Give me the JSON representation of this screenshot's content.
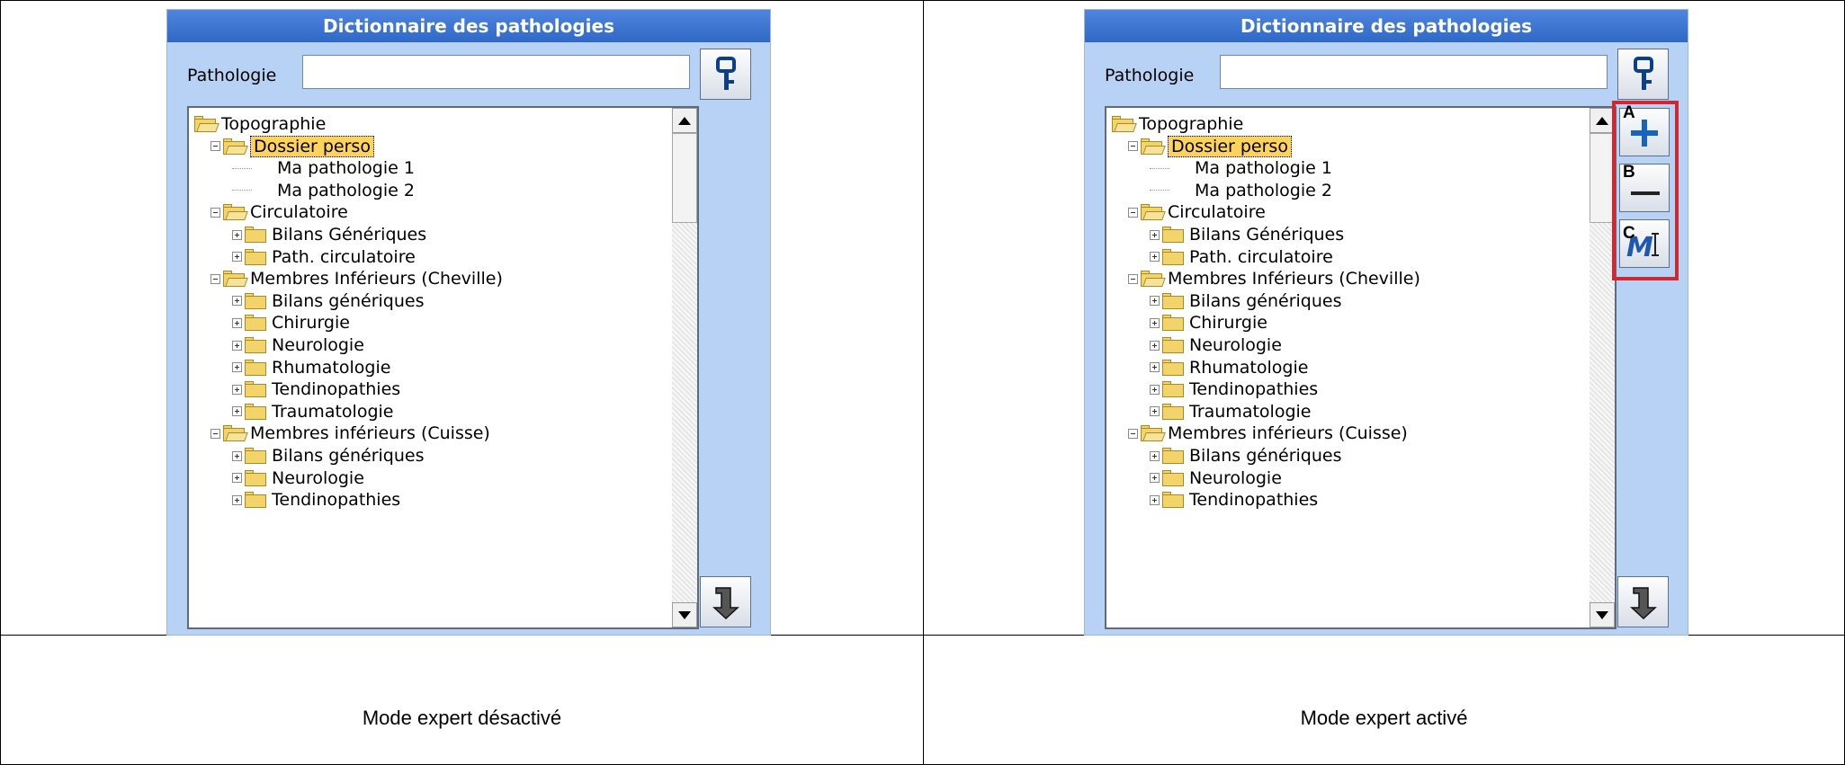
{
  "panels": [
    {
      "title": "Dictionnaire des pathologies",
      "field_label": "Pathologie",
      "field_value": "",
      "caption": "Mode expert désactivé"
    },
    {
      "title": "Dictionnaire des pathologies",
      "field_label": "Pathologie",
      "field_value": "",
      "caption": "Mode expert activé",
      "expert_buttons": [
        {
          "badge": "A",
          "icon": "plus-icon"
        },
        {
          "badge": "B",
          "icon": "minus-icon"
        },
        {
          "badge": "C",
          "icon": "rename-icon"
        }
      ]
    }
  ],
  "tree": [
    {
      "label": "Topographie",
      "level": 0,
      "type": "folder-open",
      "expander": "none"
    },
    {
      "label": "Dossier perso",
      "level": 1,
      "type": "folder-open",
      "expander": "minus",
      "selected": true
    },
    {
      "label": "Ma pathologie 1",
      "level": 2,
      "type": "leaf"
    },
    {
      "label": "Ma pathologie 2",
      "level": 2,
      "type": "leaf"
    },
    {
      "label": "Circulatoire",
      "level": 1,
      "type": "folder-open",
      "expander": "minus"
    },
    {
      "label": "Bilans Génériques",
      "level": 2,
      "type": "folder",
      "expander": "plus"
    },
    {
      "label": "Path. circulatoire",
      "level": 2,
      "type": "folder",
      "expander": "plus"
    },
    {
      "label": "Membres Inférieurs (Cheville)",
      "level": 1,
      "type": "folder-open",
      "expander": "minus"
    },
    {
      "label": "Bilans génériques",
      "level": 2,
      "type": "folder",
      "expander": "plus"
    },
    {
      "label": "Chirurgie",
      "level": 2,
      "type": "folder",
      "expander": "plus"
    },
    {
      "label": "Neurologie",
      "level": 2,
      "type": "folder",
      "expander": "plus"
    },
    {
      "label": "Rhumatologie",
      "level": 2,
      "type": "folder",
      "expander": "plus"
    },
    {
      "label": "Tendinopathies",
      "level": 2,
      "type": "folder",
      "expander": "plus"
    },
    {
      "label": "Traumatologie",
      "level": 2,
      "type": "folder",
      "expander": "plus"
    },
    {
      "label": "Membres inférieurs (Cuisse)",
      "level": 1,
      "type": "folder-open",
      "expander": "minus"
    },
    {
      "label": "Bilans génériques",
      "level": 2,
      "type": "folder",
      "expander": "plus"
    },
    {
      "label": "Neurologie",
      "level": 2,
      "type": "folder",
      "expander": "plus"
    },
    {
      "label": "Tendinopathies",
      "level": 2,
      "type": "folder",
      "expander": "plus"
    }
  ],
  "colors": {
    "panel_bg": "#b7d2f5",
    "title_bg": "#3f78d6",
    "selection": "#fdd35b",
    "highlight_box": "#d0282e",
    "plus_icon": "#1565c0"
  }
}
